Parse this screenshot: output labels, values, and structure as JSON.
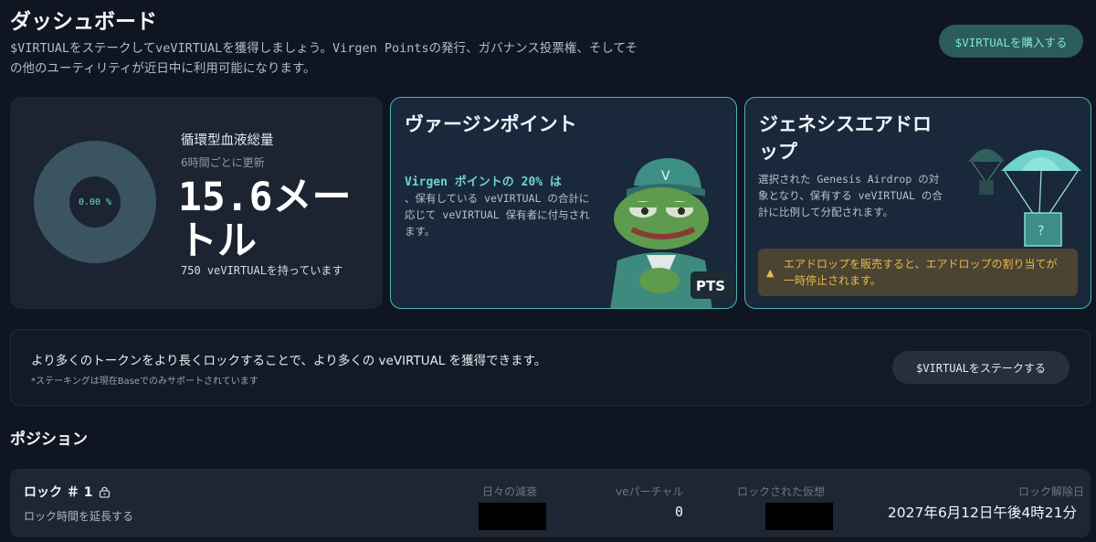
{
  "header": {
    "title": "ダッシュボード",
    "description": "$VIRTUALをステークしてveVIRTUALを獲得しましょう。Virgen Pointsの発行、ガバナンス投票権、そしてその他のユーティリティが近日中に利用可能になります。",
    "buy_button": "$VIRTUALを購入する"
  },
  "supply_card": {
    "percent": "0.00 %",
    "title": "循環型血液総量",
    "subtitle": "6時間ごとに更新",
    "value": "15.6メートル",
    "holding": "750 veVIRTUALを持っています"
  },
  "points_card": {
    "title": "ヴァージンポイント",
    "highlight": "Virgen ポイントの 20% は",
    "body": "、保有している veVIRTUAL の合計に応じて veVIRTUAL 保有者に付与されます。",
    "badge": "PTS"
  },
  "airdrop_card": {
    "title": "ジェネシスエアドロップ",
    "body": "選択された Genesis Airdrop の対象となり、保有する veVIRTUAL の合計に比例して分配されます。",
    "warning": "エアドロップを販売すると、エアドロップの割り当てが一時停止されます。"
  },
  "stake_banner": {
    "text": "より多くのトークンをより長くロックすることで、より多くの veVIRTUAL を獲得できます。",
    "note": "*ステーキングは現在Baseでのみサポートされています",
    "button": "$VIRTUALをステークする"
  },
  "positions": {
    "title": "ポジション",
    "rows": [
      {
        "name": "ロック ＃ 1",
        "extend": "ロック時間を延長する",
        "col_daily_decay": "日々の減衰",
        "col_ve_partial": "veパーチャル",
        "col_locked": "ロックされた仮想",
        "col_unlock": "ロック解除日",
        "ve_partial_value": "0",
        "unlock_date": "2027年6月12日午後4時21分"
      }
    ]
  },
  "colors": {
    "accent": "#6fd3ca",
    "card_border": "#4fb5b5",
    "warning": "#e8b84a"
  }
}
